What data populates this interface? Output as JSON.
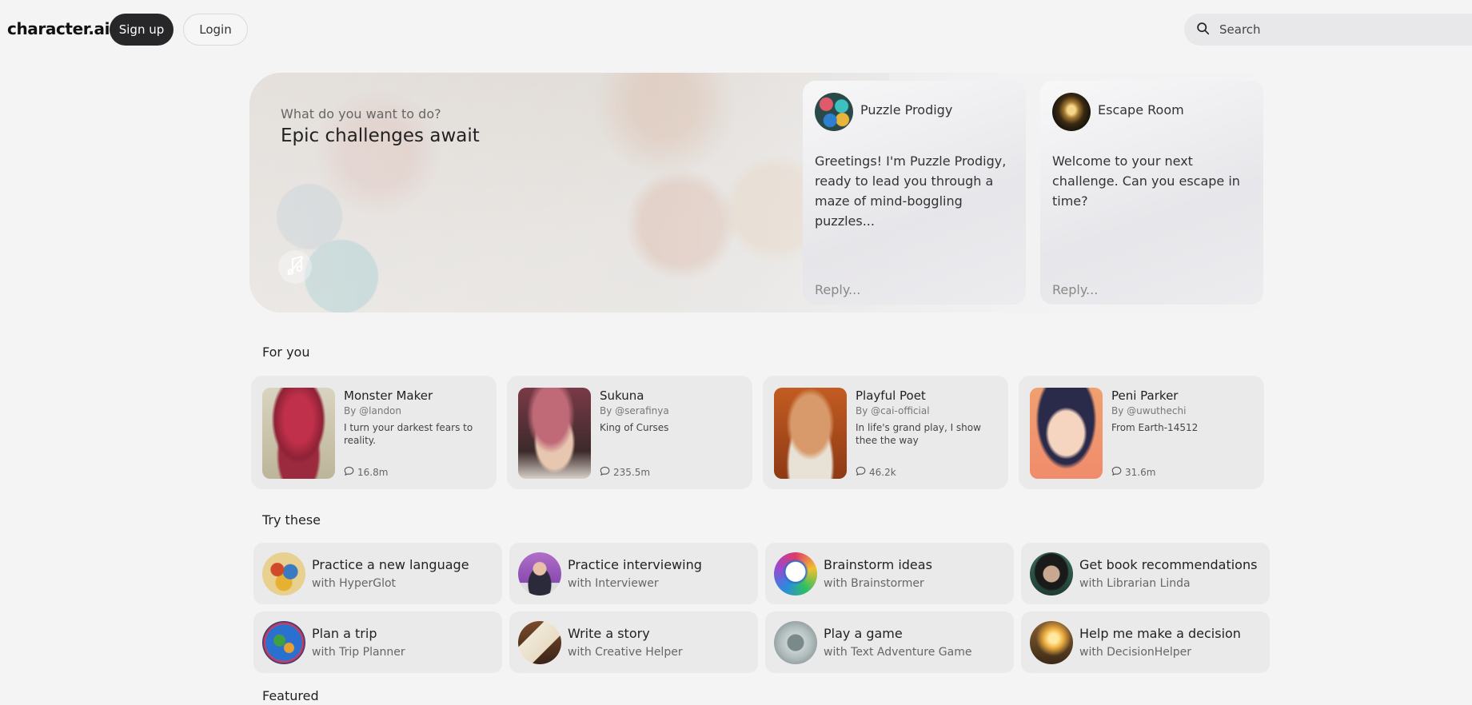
{
  "header": {
    "logo": "character.ai",
    "signup_label": "Sign up",
    "login_label": "Login",
    "search_placeholder": "Search"
  },
  "hero": {
    "subtitle": "What do you want to do?",
    "title": "Epic challenges await",
    "cards": [
      {
        "name": "Puzzle Prodigy",
        "message": "Greetings! I'm Puzzle Prodigy, ready to lead you through a maze of mind-boggling puzzles...",
        "reply_placeholder": "Reply..."
      },
      {
        "name": "Escape Room",
        "message": "Welcome to your next challenge. Can you escape in time?",
        "reply_placeholder": "Reply..."
      }
    ]
  },
  "for_you": {
    "title": "For you",
    "items": [
      {
        "name": "Monster Maker",
        "by": "By @landon",
        "desc": "I turn your darkest fears to reality.",
        "chats": "16.8m"
      },
      {
        "name": "Sukuna",
        "by": "By @serafinya",
        "desc": "King of Curses",
        "chats": "235.5m"
      },
      {
        "name": "Playful Poet",
        "by": "By @cai-official",
        "desc": "In life's grand play, I show thee the way",
        "chats": "46.2k"
      },
      {
        "name": "Peni Parker",
        "by": "By @uwuthechi",
        "desc": "From Earth-14512",
        "chats": "31.6m"
      }
    ]
  },
  "try_these": {
    "title": "Try these",
    "items": [
      {
        "title": "Practice a new language",
        "with": "with HyperGlot"
      },
      {
        "title": "Practice interviewing",
        "with": "with Interviewer"
      },
      {
        "title": "Brainstorm ideas",
        "with": "with Brainstormer"
      },
      {
        "title": "Get book recommendations",
        "with": "with Librarian Linda"
      },
      {
        "title": "Plan a trip",
        "with": "with Trip Planner"
      },
      {
        "title": "Write a story",
        "with": "with Creative Helper"
      },
      {
        "title": "Play a game",
        "with": "with Text Adventure Game"
      },
      {
        "title": "Help me make a decision",
        "with": "with DecisionHelper"
      }
    ]
  },
  "featured": {
    "title": "Featured"
  }
}
